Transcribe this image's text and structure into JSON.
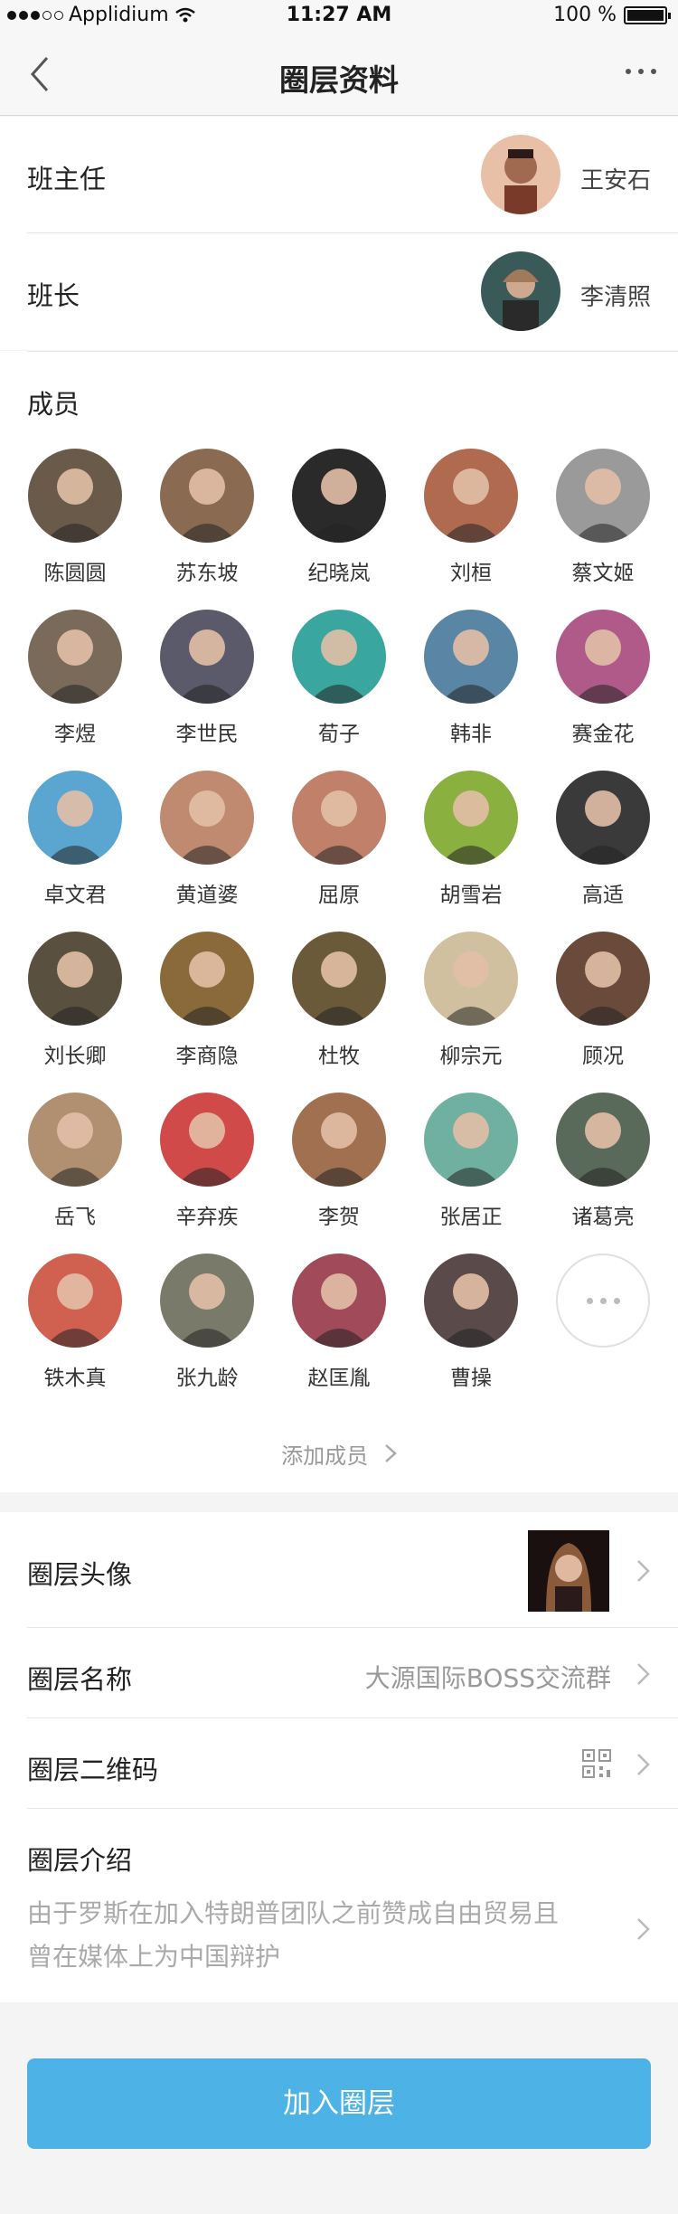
{
  "status": {
    "carrier": "Applidium",
    "time": "11:27 AM",
    "battery": "100 %"
  },
  "nav": {
    "title": "圈层资料"
  },
  "head_teacher": {
    "label": "班主任",
    "name": "王安石"
  },
  "monitor": {
    "label": "班长",
    "name": "李清照"
  },
  "members": {
    "title": "成员",
    "list": [
      {
        "name": "陈圆圆",
        "color": "#6a5a4a"
      },
      {
        "name": "苏东坡",
        "color": "#8a6a50"
      },
      {
        "name": "纪晓岚",
        "color": "#2a2a2a"
      },
      {
        "name": "刘桓",
        "color": "#b06a50"
      },
      {
        "name": "蔡文姬",
        "color": "#9a9a9a"
      },
      {
        "name": "李煜",
        "color": "#7a6a5a"
      },
      {
        "name": "李世民",
        "color": "#5a5a6a"
      },
      {
        "name": "荀子",
        "color": "#3aa6a0"
      },
      {
        "name": "韩非",
        "color": "#5a86a6"
      },
      {
        "name": "赛金花",
        "color": "#b05a8a"
      },
      {
        "name": "卓文君",
        "color": "#5aa6d0"
      },
      {
        "name": "黄道婆",
        "color": "#c08a70"
      },
      {
        "name": "屈原",
        "color": "#c0806a"
      },
      {
        "name": "胡雪岩",
        "color": "#8ab040"
      },
      {
        "name": "高适",
        "color": "#3a3a3a"
      },
      {
        "name": "刘长卿",
        "color": "#5a5040"
      },
      {
        "name": "李商隐",
        "color": "#8a6a3a"
      },
      {
        "name": "杜牧",
        "color": "#6a5a3a"
      },
      {
        "name": "柳宗元",
        "color": "#d0c0a0"
      },
      {
        "name": "顾况",
        "color": "#6a4a3a"
      },
      {
        "name": "岳飞",
        "color": "#b09070"
      },
      {
        "name": "辛弃疾",
        "color": "#d04a4a"
      },
      {
        "name": "李贺",
        "color": "#a07050"
      },
      {
        "name": "张居正",
        "color": "#70b0a0"
      },
      {
        "name": "诸葛亮",
        "color": "#5a6a5a"
      },
      {
        "name": "铁木真",
        "color": "#d06050"
      },
      {
        "name": "张九龄",
        "color": "#7a7a6a"
      },
      {
        "name": "赵匡胤",
        "color": "#a04a5a"
      },
      {
        "name": "曹操",
        "color": "#5a4a4a"
      }
    ],
    "add_label": "添加成员"
  },
  "circle_avatar": {
    "label": "圈层头像"
  },
  "circle_name": {
    "label": "圈层名称",
    "value": "大源国际BOSS交流群"
  },
  "circle_qr": {
    "label": "圈层二维码"
  },
  "circle_intro": {
    "label": "圈层介绍",
    "line1": "由于罗斯在加入特朗普团队之前赞成自由贸易且",
    "line2": "曾在媒体上为中国辩护"
  },
  "join_label": "加入圈层"
}
